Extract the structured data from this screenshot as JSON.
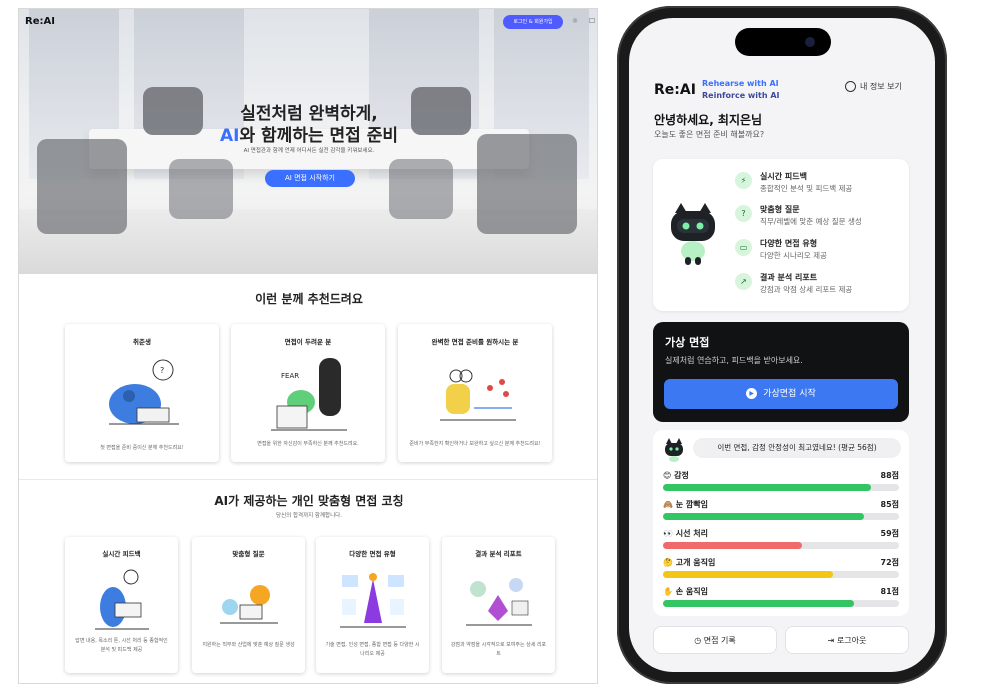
{
  "desktop": {
    "logo": "Re:AI",
    "login_button": "로그인 & 회원가입",
    "hero": {
      "title_line1": "실전처럼 완벽하게,",
      "title_line2_accent": "AI",
      "title_line2_rest": "와 함께하는 면접 준비",
      "subtitle": "AI 면접관과 함께 언제 어디서든 실전 감각을 키워보세요.",
      "cta": "AI 면접 시작하기"
    },
    "recommend": {
      "title": "이런 분께 추천드려요",
      "cards": [
        {
          "title": "취준생",
          "desc": "첫 면접을 준비 중이신 분께 추천드려요!"
        },
        {
          "title": "면접이 두려운 분",
          "desc": "면접을 위한 자신감이 부족하신 분께 추천드려요."
        },
        {
          "title": "완벽한 면접 준비를 원하시는 분",
          "desc": "준비가 부족한지 확인하거나 보완하고 싶으신 분께 추천드려요!"
        }
      ]
    },
    "coaching": {
      "title": "AI가 제공하는 개인 맞춤형 면접 코칭",
      "subtitle": "당신의 합격까지 함께합니다.",
      "cards": [
        {
          "title": "실시간 피드백",
          "desc": "답변 내용, 목소리 톤, 시선 처리 등 종합적인 분석 및 피드백 제공"
        },
        {
          "title": "맞춤형 질문",
          "desc": "지원하는 직무와 산업에 맞춘 예상 질문 생성"
        },
        {
          "title": "다양한 면접 유형",
          "desc": "기술 면접, 인성 면접, 종합 면접 등 다양한 시나리오 제공"
        },
        {
          "title": "결과 분석 리포트",
          "desc": "강점과 약점을 시각적으로 보여주는 상세 리포트"
        }
      ]
    }
  },
  "mobile": {
    "logo": "Re:AI",
    "tagline1": "Rehearse with AI",
    "tagline2": "Reinforce with AI",
    "profile_label": "내 정보 보기",
    "greeting": "안녕하세요, 최지은님",
    "greeting_sub": "오늘도 좋은 면접 준비 해볼까요?",
    "features": [
      {
        "icon": "lightning-icon",
        "title": "실시간 피드백",
        "desc": "종합적인 분석 및 피드백 제공"
      },
      {
        "icon": "question-icon",
        "title": "맞춤형 질문",
        "desc": "직무/레벨에 맞춘 예상 질문 생성"
      },
      {
        "icon": "window-icon",
        "title": "다양한 면접 유형",
        "desc": "다양한 시나리오 제공"
      },
      {
        "icon": "trend-icon",
        "title": "결과 분석 리포트",
        "desc": "강점과 약점 상세 리포트 제공"
      }
    ],
    "virtual": {
      "title": "가상 면접",
      "subtitle": "실제처럼 연습하고, 피드백을 받아보세요.",
      "button": "가상면접 시작"
    },
    "result": {
      "bubble": "이번 면접, 감정 안정성이 최고였네요! (평균 56점)",
      "metrics": [
        {
          "emoji": "😊",
          "label": "감정",
          "value": 88,
          "value_text": "88점",
          "color": "#33c463"
        },
        {
          "emoji": "🙈",
          "label": "눈 깜빡임",
          "value": 85,
          "value_text": "85점",
          "color": "#33c463"
        },
        {
          "emoji": "👀",
          "label": "시선 처리",
          "value": 59,
          "value_text": "59점",
          "color": "#ef6b6b"
        },
        {
          "emoji": "🤔",
          "label": "고개 움직임",
          "value": 72,
          "value_text": "72점",
          "color": "#f2c516"
        },
        {
          "emoji": "✋",
          "label": "손 움직임",
          "value": 81,
          "value_text": "81점",
          "color": "#33c463"
        }
      ]
    },
    "footer": {
      "history": "면접 기록",
      "logout": "로그아웃"
    }
  },
  "colors": {
    "accent": "#3b6fff",
    "dark_card": "#111214",
    "login_button": "#4f5bff"
  }
}
